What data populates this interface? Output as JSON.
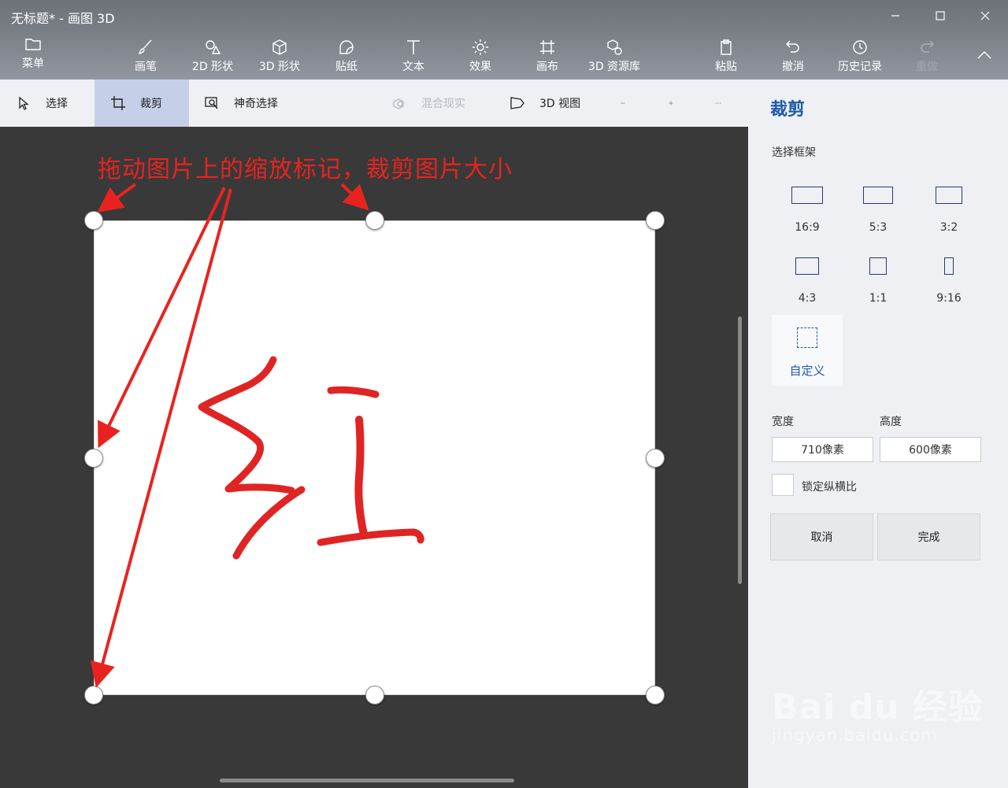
{
  "window": {
    "title": "无标题* - 画图 3D"
  },
  "ribbon": {
    "menu": "菜单",
    "brushes": "画笔",
    "shapes_2d": "2D 形状",
    "shapes_3d": "3D 形状",
    "stickers": "贴纸",
    "text": "文本",
    "effects": "效果",
    "canvas": "画布",
    "library_3d": "3D 资源库",
    "paste": "粘贴",
    "undo": "撤消",
    "history": "历史记录",
    "redo": "重做"
  },
  "toolbar": {
    "select": "选择",
    "crop": "裁剪",
    "magic_select": "神奇选择",
    "mixed_reality": "混合现实",
    "view_3d": "3D 视图"
  },
  "annotation": "拖动图片上的缩放标记，裁剪图片大小",
  "panel": {
    "title": "裁剪",
    "frame_label": "选择框架",
    "ratios": [
      "16:9",
      "5:3",
      "3:2",
      "4:3",
      "1:1",
      "9:16"
    ],
    "custom": "自定义",
    "width_label": "宽度",
    "height_label": "高度",
    "width_value": "710像素",
    "height_value": "600像素",
    "lock_label": "锁定纵横比",
    "cancel": "取消",
    "done": "完成"
  },
  "watermark": {
    "brand": "Bai du 经验",
    "url": "jingyan.baidu.com"
  },
  "colors": {
    "accent": "#1e5aa8",
    "annotation": "#e8231f",
    "stroke": "#e02424"
  }
}
